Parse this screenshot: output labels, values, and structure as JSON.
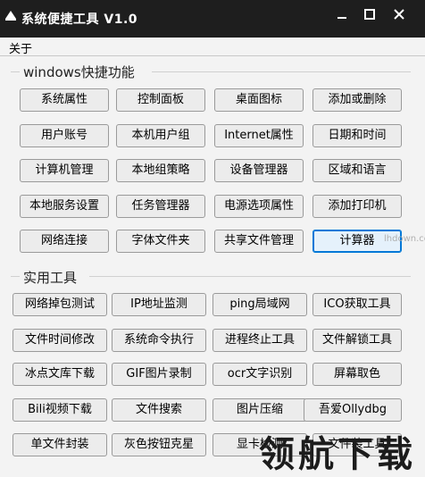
{
  "window": {
    "title": "系统便捷工具 V1.0"
  },
  "menu": {
    "about": "关于"
  },
  "groups": {
    "windows": {
      "title": "windows快捷功能",
      "buttons": [
        "系统属性",
        "控制面板",
        "桌面图标",
        "添加或删除",
        "用户账号",
        "本机用户组",
        "Internet属性",
        "日期和时间",
        "计算机管理",
        "本地组策略",
        "设备管理器",
        "区域和语言",
        "本地服务设置",
        "任务管理器",
        "电源选项属性",
        "添加打印机",
        "网络连接",
        "字体文件夹",
        "共享文件管理",
        "计算器"
      ]
    },
    "tools": {
      "title": "实用工具",
      "buttons": [
        "网络掉包测试",
        "IP地址监测",
        "ping局域网",
        "ICO获取工具",
        "文件时间修改",
        "系统命令执行",
        "进程终止工具",
        "文件解锁工具",
        "冰点文库下载",
        "GIF图片录制",
        "ocr文字识别",
        "屏幕取色",
        "Bili视频下载",
        "文件搜索",
        "图片压缩",
        "吾爱Ollydbg",
        "单文件封装",
        "灰色按钮克星",
        "显卡检测",
        "文件装工具"
      ]
    }
  },
  "watermark": {
    "text": "领航下载",
    "url": "lhdown.com"
  }
}
